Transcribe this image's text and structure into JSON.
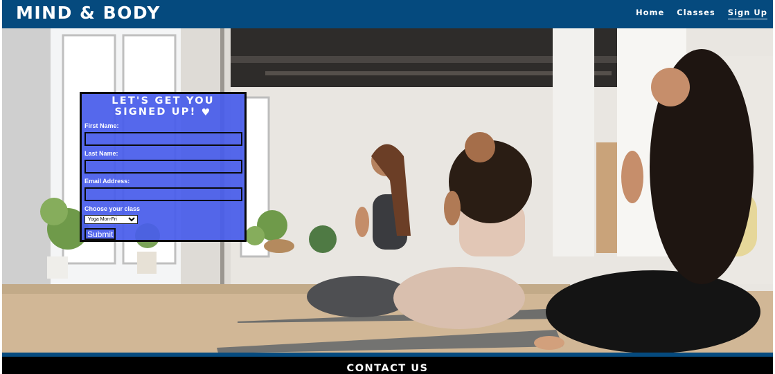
{
  "header": {
    "brand": "MIND & BODY",
    "nav": [
      {
        "label": "Home"
      },
      {
        "label": "Classes"
      },
      {
        "label": "Sign Up"
      }
    ]
  },
  "form": {
    "title": "LET'S GET YOU SIGNED UP!",
    "title_icon": "heart-pulse-icon",
    "first_name_label": "First Name:",
    "first_name_value": "",
    "last_name_label": "Last Name:",
    "last_name_value": "",
    "email_label": "Email Address:",
    "email_value": "",
    "class_label": "Choose your class",
    "class_selected": "Yoga Mon-Fri",
    "submit_label": "Submit"
  },
  "footer": {
    "title": "CONTACT US"
  },
  "colors": {
    "header_bg": "#054a7e",
    "form_bg": "#485cec",
    "footer_bg": "#000000"
  }
}
